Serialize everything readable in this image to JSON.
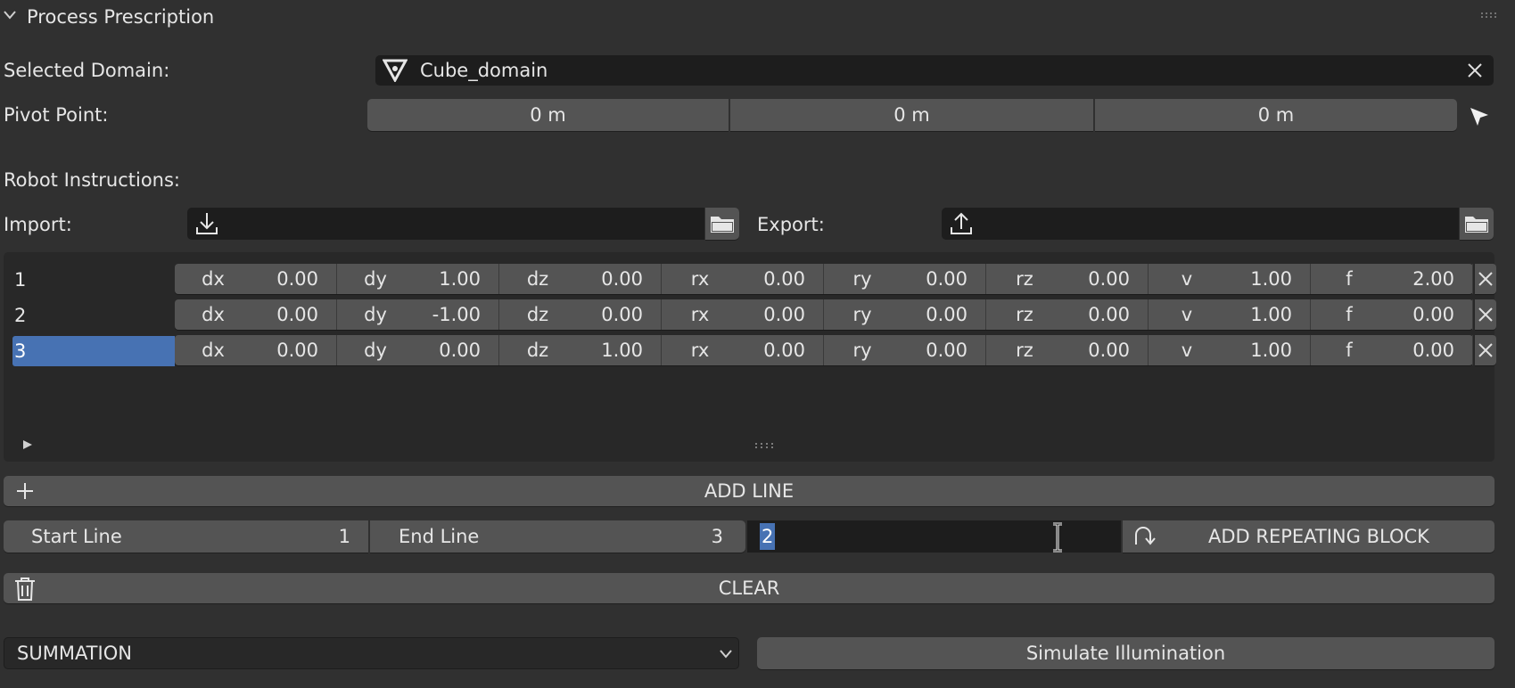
{
  "panel": {
    "title": "Process Prescription"
  },
  "domain": {
    "label": "Selected Domain:",
    "value": "Cube_domain"
  },
  "pivot": {
    "label": "Pivot Point:",
    "x": "0 m",
    "y": "0 m",
    "z": "0 m"
  },
  "robot": {
    "heading": "Robot Instructions:",
    "import_label": "Import:",
    "export_label": "Export:"
  },
  "rows": [
    {
      "index": "1",
      "dx": "0.00",
      "dy": "1.00",
      "dz": "0.00",
      "rx": "0.00",
      "ry": "0.00",
      "rz": "0.00",
      "v": "1.00",
      "f": "2.00",
      "selected": false
    },
    {
      "index": "2",
      "dx": "0.00",
      "dy": "-1.00",
      "dz": "0.00",
      "rx": "0.00",
      "ry": "0.00",
      "rz": "0.00",
      "v": "1.00",
      "f": "0.00",
      "selected": false
    },
    {
      "index": "3",
      "dx": "0.00",
      "dy": "0.00",
      "dz": "1.00",
      "rx": "0.00",
      "ry": "0.00",
      "rz": "0.00",
      "v": "1.00",
      "f": "0.00",
      "selected": true
    }
  ],
  "column_keys": [
    "dx",
    "dy",
    "dz",
    "rx",
    "ry",
    "rz",
    "v",
    "f"
  ],
  "buttons": {
    "add_line": "ADD LINE",
    "start_line_label": "Start Line",
    "start_line_value": "1",
    "end_line_label": "End Line",
    "end_line_value": "3",
    "repeat_input_value": "2",
    "add_repeating_block": "ADD REPEATING BLOCK",
    "clear": "CLEAR",
    "mode_select": "SUMMATION",
    "simulate": "Simulate Illumination"
  },
  "colors": {
    "background": "#303030",
    "field": "#545454",
    "dark_field": "#1d1d1d",
    "selection": "#4772b3"
  }
}
